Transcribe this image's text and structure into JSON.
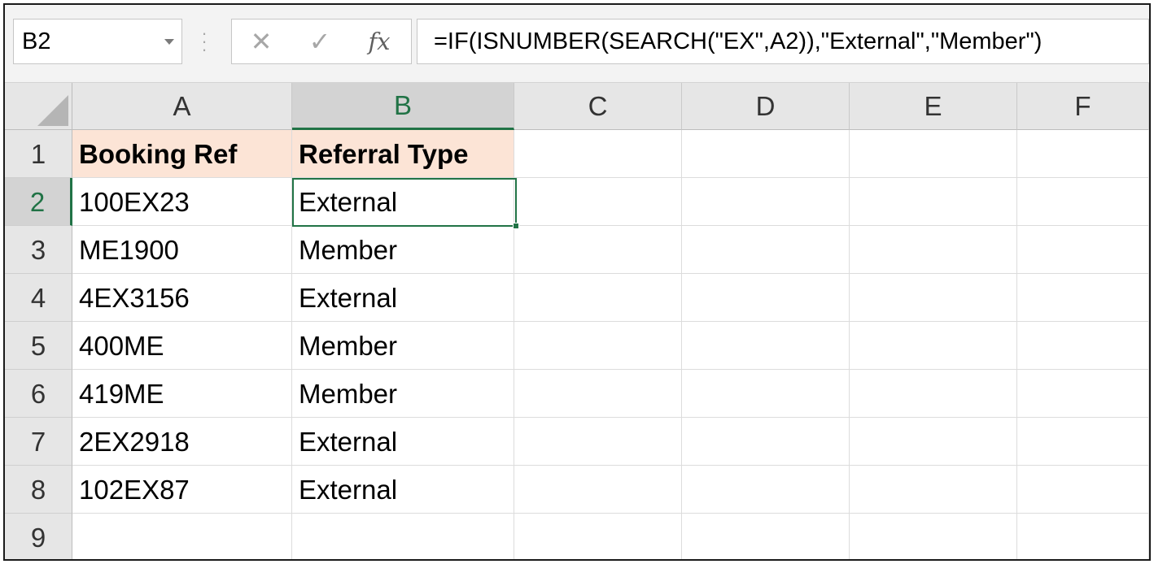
{
  "formula_bar": {
    "name_box": "B2",
    "cancel_icon": "close-icon",
    "enter_icon": "check-icon",
    "function_icon": "fx",
    "formula": "=IF(ISNUMBER(SEARCH(\"EX\",A2)),\"External\",\"Member\")"
  },
  "accent_color": "#217346",
  "header_fill_color": "#fce4d6",
  "columns": [
    "A",
    "B",
    "C",
    "D",
    "E",
    "F"
  ],
  "rows": [
    "1",
    "2",
    "3",
    "4",
    "5",
    "6",
    "7",
    "8",
    "9"
  ],
  "selected_cell": "B2",
  "cells": {
    "A1": "Booking Ref",
    "B1": "Referral Type",
    "A2": "100EX23",
    "B2": "External",
    "A3": "ME1900",
    "B3": "Member",
    "A4": "4EX3156",
    "B4": "External",
    "A5": "400ME",
    "B5": "Member",
    "A6": "419ME",
    "B6": "Member",
    "A7": "2EX2918",
    "B7": "External",
    "A8": "102EX87",
    "B8": "External"
  }
}
